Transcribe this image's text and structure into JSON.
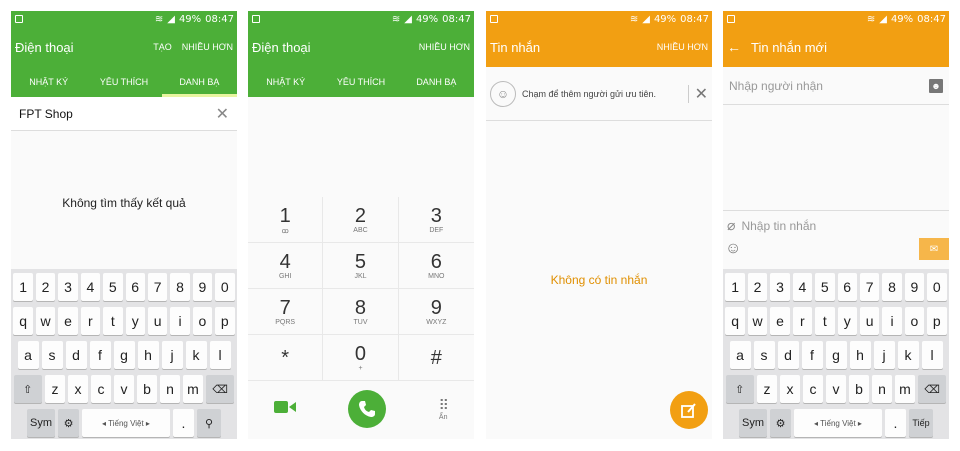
{
  "status": {
    "signal": "◢",
    "battery": "49%",
    "time": "08:47"
  },
  "phone1": {
    "title": "Điện thoại",
    "actions": [
      "TẠO",
      "NHIỀU HƠN"
    ],
    "tabs": [
      "NHẬT KÝ",
      "YÊU THÍCH",
      "DANH BẠ"
    ],
    "active_tab": "DANH BẠ",
    "search_value": "FPT Shop",
    "empty": "Không tìm thấy kết quả",
    "accent": "#4caf38"
  },
  "phone2": {
    "title": "Điện thoại",
    "action": "NHIỀU HƠN",
    "tabs": [
      "NHẬT KÝ",
      "YÊU THÍCH",
      "DANH BẠ"
    ],
    "keys": [
      {
        "d": "1",
        "s": "ꝏ"
      },
      {
        "d": "2",
        "s": "ABC"
      },
      {
        "d": "3",
        "s": "DEF"
      },
      {
        "d": "4",
        "s": "GHI"
      },
      {
        "d": "5",
        "s": "JKL"
      },
      {
        "d": "6",
        "s": "MNO"
      },
      {
        "d": "7",
        "s": "PQRS"
      },
      {
        "d": "8",
        "s": "TUV"
      },
      {
        "d": "9",
        "s": "WXYZ"
      },
      {
        "d": "*",
        "s": ""
      },
      {
        "d": "0",
        "s": "+"
      },
      {
        "d": "#",
        "s": ""
      }
    ],
    "hide_label": "Ẩn"
  },
  "phone3": {
    "title": "Tin nhắn",
    "action": "NHIỀU HƠN",
    "priority_hint": "Chạm để thêm người gửi ưu tiên.",
    "empty": "Không có tin nhắn",
    "accent": "#f29f12"
  },
  "phone4": {
    "title": "Tin nhắn mới",
    "recipient_placeholder": "Nhập người nhận",
    "message_placeholder": "Nhập tin nhắn"
  },
  "keyboard": {
    "row1": [
      "1",
      "2",
      "3",
      "4",
      "5",
      "6",
      "7",
      "8",
      "9",
      "0"
    ],
    "row2": [
      "q",
      "w",
      "e",
      "r",
      "t",
      "y",
      "u",
      "i",
      "o",
      "p"
    ],
    "row3": [
      "a",
      "s",
      "d",
      "f",
      "g",
      "h",
      "j",
      "k",
      "l"
    ],
    "row4": [
      "z",
      "x",
      "c",
      "v",
      "b",
      "n",
      "m"
    ],
    "sym": "Sym",
    "space": "◂ Tiếng Việt ▸",
    "period": ".",
    "next_label": "Tiếp"
  }
}
